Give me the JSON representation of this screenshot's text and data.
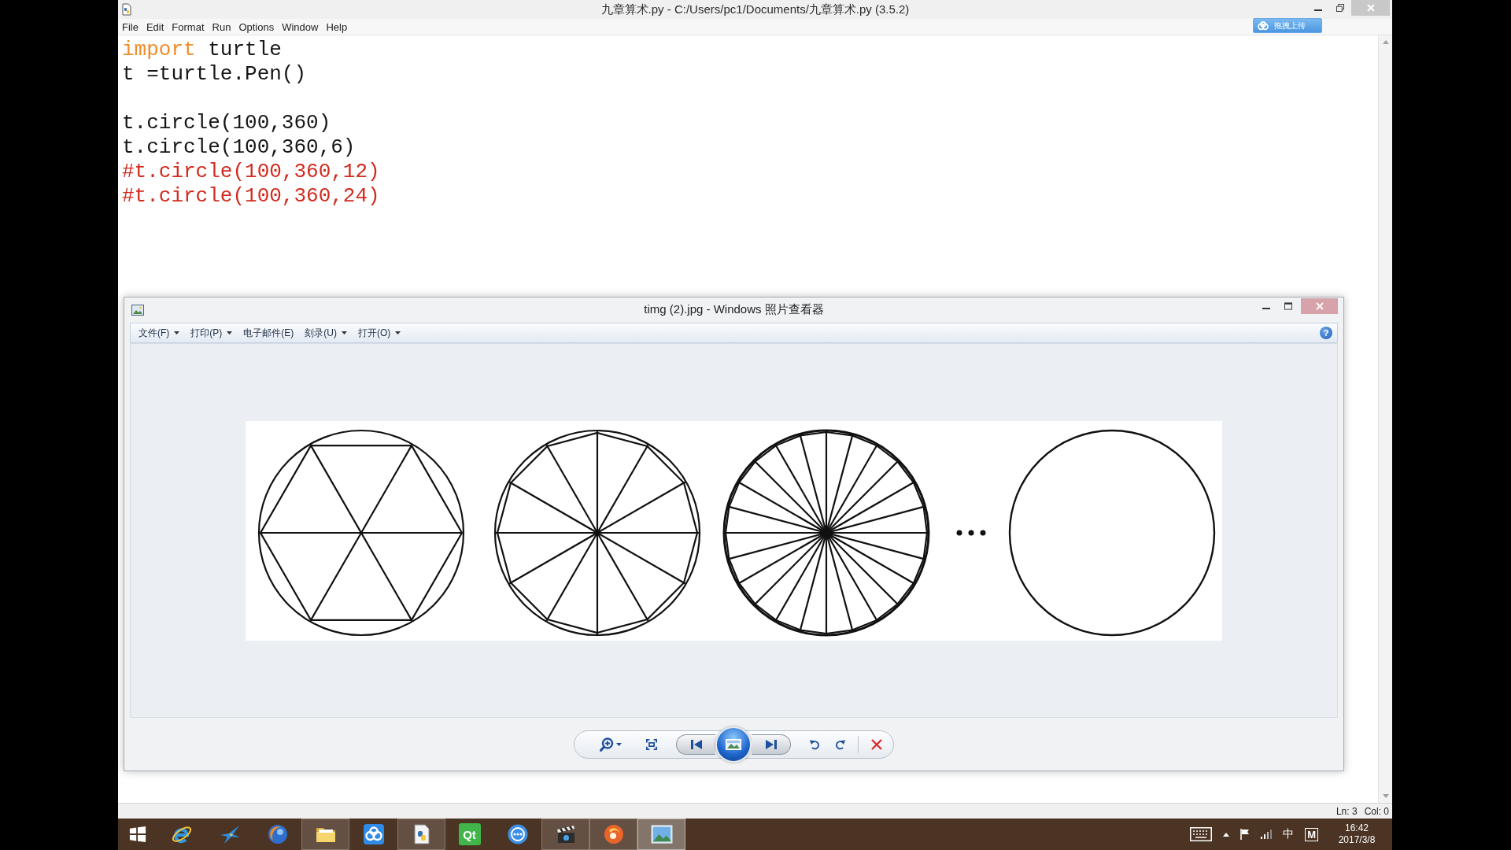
{
  "editor_window": {
    "title": "九章算术.py - C:/Users/pc1/Documents/九章算术.py (3.5.2)",
    "upload_button": "拖拽上传"
  },
  "menu": [
    "File",
    "Edit",
    "Format",
    "Run",
    "Options",
    "Window",
    "Help"
  ],
  "code_lines": [
    {
      "kind": "code",
      "tokens": [
        {
          "kind": "keyword",
          "text": "import"
        },
        {
          "kind": "plain",
          "text": " turtle"
        }
      ]
    },
    {
      "kind": "code",
      "tokens": [
        {
          "kind": "plain",
          "text": "t =turtle.Pen()"
        }
      ]
    },
    {
      "kind": "blank"
    },
    {
      "kind": "code",
      "tokens": [
        {
          "kind": "plain",
          "text": "t.circle(100,360)"
        }
      ]
    },
    {
      "kind": "code",
      "tokens": [
        {
          "kind": "plain",
          "text": "t.circle(100,360,6)"
        }
      ]
    },
    {
      "kind": "code",
      "tokens": [
        {
          "kind": "comment",
          "text": "#t.circle(100,360,12)"
        }
      ]
    },
    {
      "kind": "code",
      "tokens": [
        {
          "kind": "comment",
          "text": "#t.circle(100,360,24)"
        }
      ]
    }
  ],
  "photo_viewer": {
    "title": "timg (2).jpg - Windows 照片查看器",
    "menu": [
      {
        "label": "文件(F)",
        "dropdown": true
      },
      {
        "label": "打印(P)",
        "dropdown": true
      },
      {
        "label": "电子邮件(E)",
        "dropdown": false
      },
      {
        "label": "刻录(U)",
        "dropdown": true
      },
      {
        "label": "打开(O)",
        "dropdown": true
      }
    ],
    "help": "?"
  },
  "status_bar": {
    "line": "Ln: 3",
    "column": "Col: 0"
  },
  "taskbar": {
    "buttons": [
      {
        "kind": "start",
        "running": false,
        "selected": false
      },
      {
        "kind": "browser",
        "running": false,
        "selected": false
      },
      {
        "kind": "bird",
        "running": false,
        "selected": false
      },
      {
        "kind": "orb",
        "running": false,
        "selected": false
      },
      {
        "kind": "folder",
        "running": true,
        "selected": false
      },
      {
        "kind": "cloud",
        "running": false,
        "selected": false
      },
      {
        "kind": "document",
        "running": true,
        "selected": false
      },
      {
        "kind": "tile",
        "label": "Qt",
        "running": false,
        "selected": false
      },
      {
        "kind": "dial",
        "running": false,
        "selected": false
      },
      {
        "kind": "clapper",
        "running": true,
        "selected": false
      },
      {
        "kind": "fireball",
        "running": true,
        "selected": false
      },
      {
        "kind": "picture",
        "running": true,
        "selected": true
      }
    ],
    "tray": {
      "ime": "中",
      "app": "M",
      "time": "16:42",
      "date": "2017/3/8"
    }
  }
}
